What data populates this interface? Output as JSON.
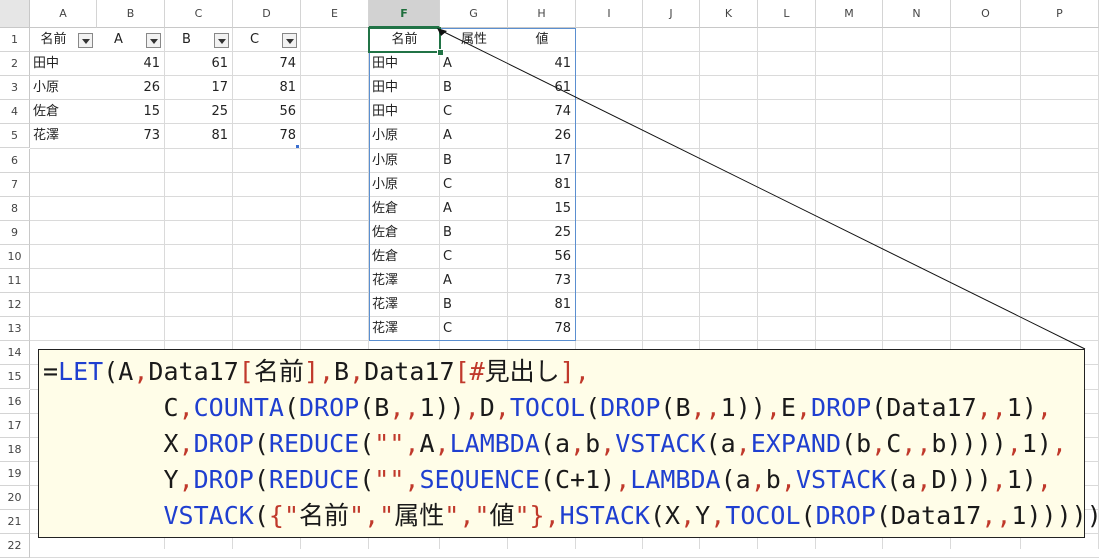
{
  "columns": [
    "A",
    "B",
    "C",
    "D",
    "E",
    "F",
    "G",
    "H",
    "I",
    "J",
    "K",
    "L",
    "M",
    "N",
    "O",
    "P"
  ],
  "rows": [
    "1",
    "2",
    "3",
    "4",
    "5",
    "6",
    "7",
    "8",
    "9",
    "10",
    "11",
    "12",
    "13",
    "14",
    "15",
    "16",
    "17",
    "18",
    "19",
    "20",
    "21",
    "22"
  ],
  "source_table": {
    "headers": [
      "名前",
      "A",
      "B",
      "C"
    ],
    "rows": [
      [
        "田中",
        "41",
        "61",
        "74"
      ],
      [
        "小原",
        "26",
        "17",
        "81"
      ],
      [
        "佐倉",
        "15",
        "25",
        "56"
      ],
      [
        "花澤",
        "73",
        "81",
        "78"
      ]
    ]
  },
  "result_table": {
    "headers": [
      "名前",
      "属性",
      "値"
    ],
    "rows": [
      [
        "田中",
        "A",
        "41"
      ],
      [
        "田中",
        "B",
        "61"
      ],
      [
        "田中",
        "C",
        "74"
      ],
      [
        "小原",
        "A",
        "26"
      ],
      [
        "小原",
        "B",
        "17"
      ],
      [
        "小原",
        "C",
        "81"
      ],
      [
        "佐倉",
        "A",
        "15"
      ],
      [
        "佐倉",
        "B",
        "25"
      ],
      [
        "佐倉",
        "C",
        "56"
      ],
      [
        "花澤",
        "A",
        "73"
      ],
      [
        "花澤",
        "B",
        "81"
      ],
      [
        "花澤",
        "C",
        "78"
      ]
    ]
  },
  "formula_lines": [
    "=LET(A,Data17[名前],B,Data17[#見出し],",
    "        C,COUNTA(DROP(B,,1)),D,TOCOL(DROP(B,,1)),E,DROP(Data17,,1),",
    "        X,DROP(REDUCE(\"\",A,LAMBDA(a,b,VSTACK(a,EXPAND(b,C,,b)))),1),",
    "        Y,DROP(REDUCE(\"\",SEQUENCE(C+1),LAMBDA(a,b,VSTACK(a,D))),1),",
    "        VSTACK({\"名前\",\"属性\",\"値\"},HSTACK(X,Y,TOCOL(DROP(Data17,,1)))))"
  ],
  "colors": {
    "function": "#1f3fd0",
    "separator": "#c0392b",
    "text": "#1a1a1a",
    "selection": "#217346",
    "table_border": "#5b8fd0"
  }
}
